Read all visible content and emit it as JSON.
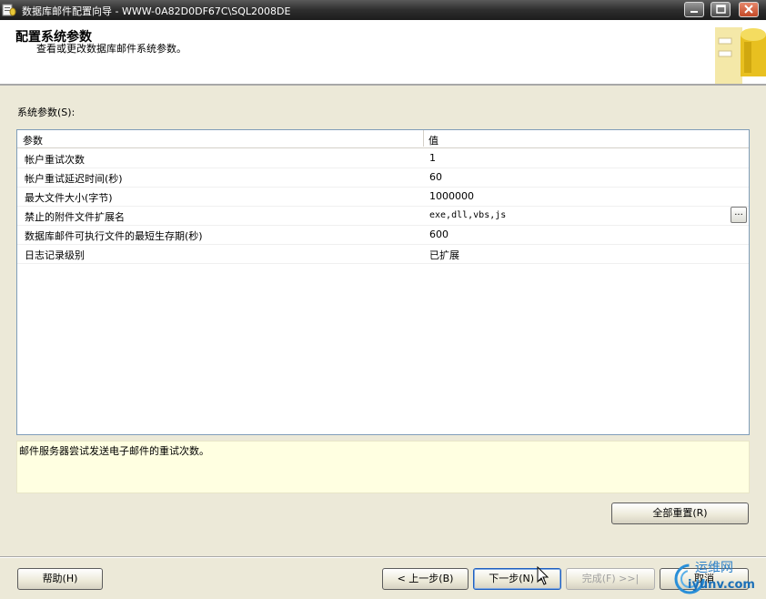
{
  "window": {
    "title": "数据库邮件配置向导 - WWW-0A82D0DF67C\\SQL2008DE"
  },
  "header": {
    "title": "配置系统参数",
    "subtitle": "查看或更改数据库邮件系统参数。"
  },
  "section": {
    "label": "系统参数(S):"
  },
  "grid": {
    "columns": [
      "参数",
      "值"
    ],
    "rows": [
      {
        "param": "帐户重试次数",
        "value": "1"
      },
      {
        "param": "帐户重试延迟时间(秒)",
        "value": "60"
      },
      {
        "param": "最大文件大小(字节)",
        "value": "1000000"
      },
      {
        "param": "禁止的附件文件扩展名",
        "value": "exe,dll,vbs,js",
        "ellipsis": "..."
      },
      {
        "param": "数据库邮件可执行文件的最短生存期(秒)",
        "value": "600"
      },
      {
        "param": "日志记录级别",
        "value": "已扩展"
      }
    ]
  },
  "description": {
    "text": "邮件服务器尝试发送电子邮件的重试次数。"
  },
  "buttons": {
    "reset_all": "全部重置(R)",
    "help": "帮助(H)",
    "back": "< 上一步(B)",
    "next": "下一步(N) >",
    "finish": "完成(F) >>|",
    "cancel": "取消"
  },
  "watermark": {
    "line1": "运维网",
    "line2": "iyunv.com"
  },
  "icons": {
    "app": "database-mail-icon",
    "header_graphic": "database-cylinder-icon",
    "cursor": "mouse-pointer-icon"
  },
  "colors": {
    "titlebar": "#2e2e2e",
    "dialog_bg": "#ece9d8",
    "description_bg": "#ffffe1",
    "focus_border": "#1f5fbf"
  }
}
